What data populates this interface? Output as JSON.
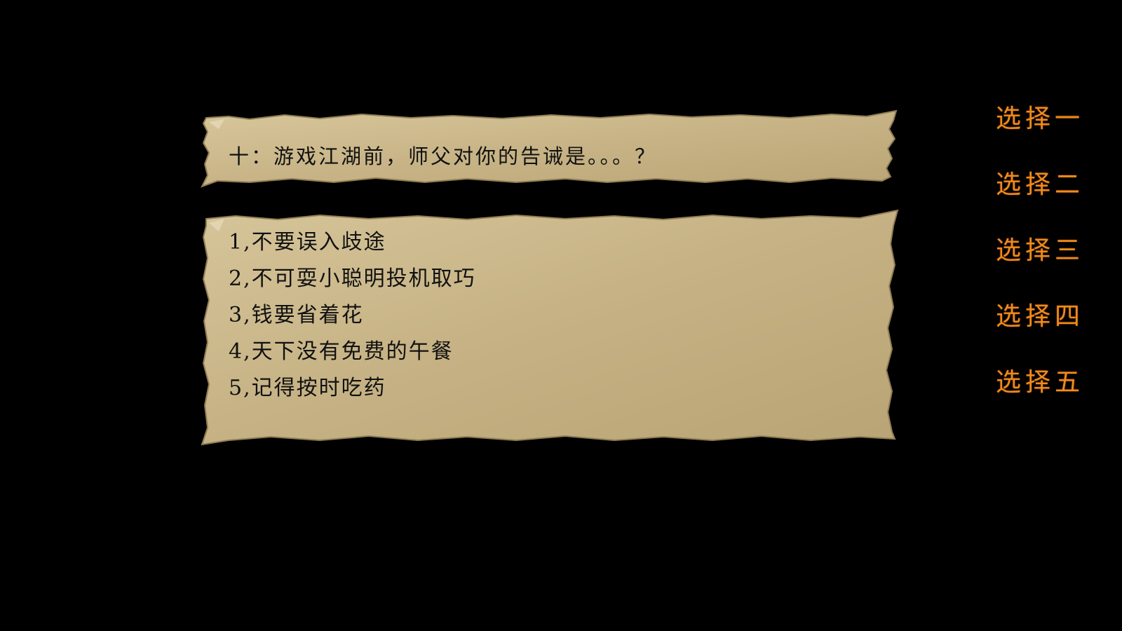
{
  "question": {
    "text": "十：游戏江湖前，师父对你的告诫是。。。？"
  },
  "answers": [
    "1,不要误入歧途",
    "2,不可耍小聪明投机取巧",
    "3,钱要省着花",
    "4,天下没有免费的午餐",
    "5,记得按时吃药"
  ],
  "choices": [
    "选择一",
    "选择二",
    "选择三",
    "选择四",
    "选择五"
  ],
  "colors": {
    "background": "#000000",
    "parchment": "#c9b58a",
    "choice_text": "#f08b1c",
    "body_text": "#111111"
  }
}
